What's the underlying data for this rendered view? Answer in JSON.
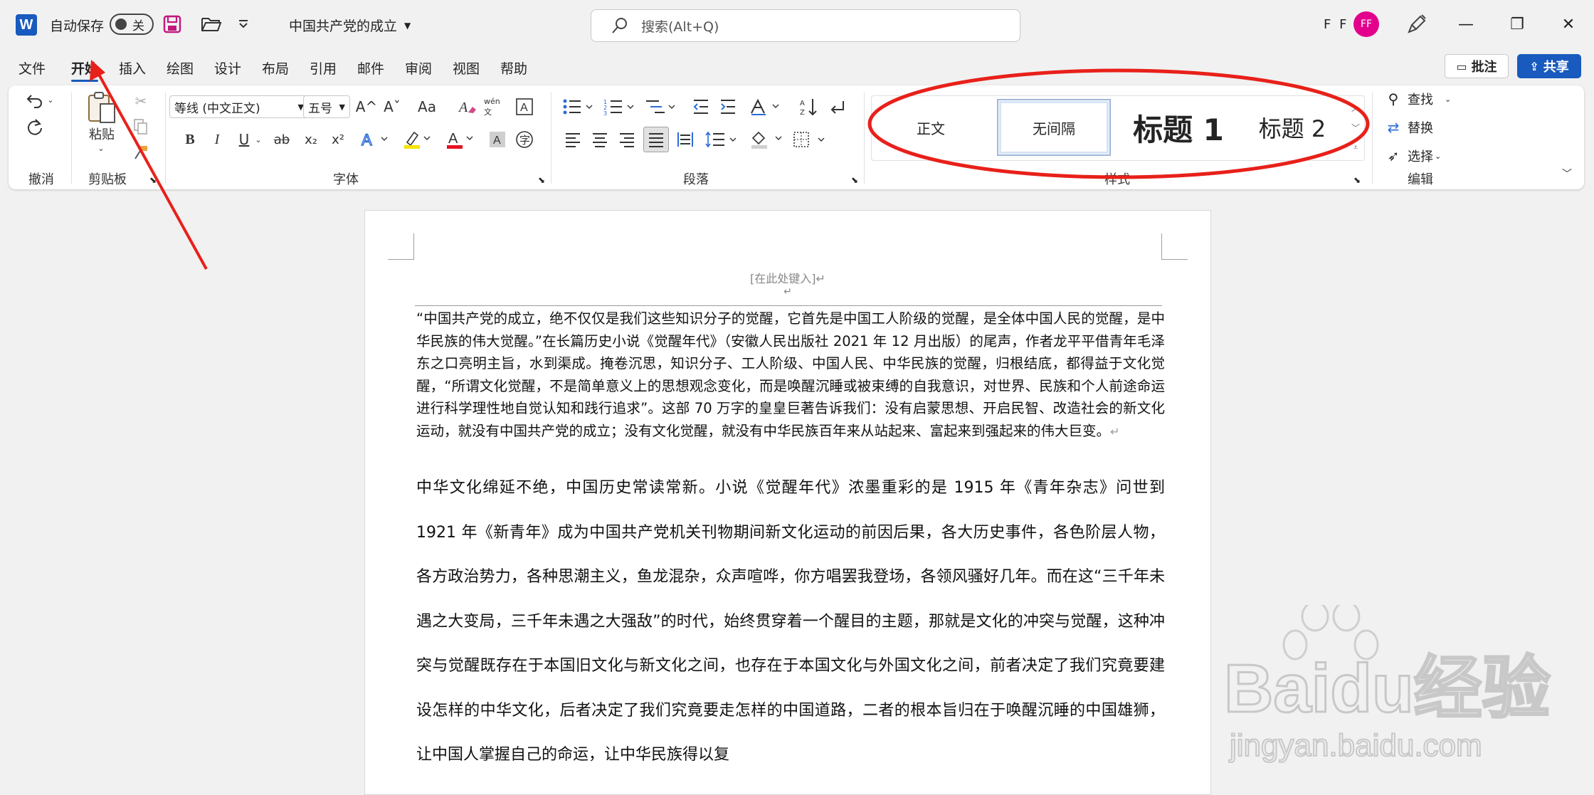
{
  "titlebar": {
    "app_logo": "W",
    "autosave_label": "自动保存",
    "autosave_state": "关",
    "doc_title": "中国共产党的成立",
    "search_placeholder": "搜索(Alt+Q)",
    "user_initials": "F F",
    "avatar_text": "FF",
    "minimize_glyph": "—",
    "restore_glyph": "❐",
    "close_glyph": "✕"
  },
  "tabs": [
    {
      "label": "文件"
    },
    {
      "label": "开始",
      "active": true
    },
    {
      "label": "插入"
    },
    {
      "label": "绘图"
    },
    {
      "label": "设计"
    },
    {
      "label": "布局"
    },
    {
      "label": "引用"
    },
    {
      "label": "邮件"
    },
    {
      "label": "审阅"
    },
    {
      "label": "视图"
    },
    {
      "label": "帮助"
    }
  ],
  "actions": {
    "comment": "批注",
    "share": "共享"
  },
  "ribbon": {
    "groups": {
      "undo": "撤消",
      "clipboard": "剪贴板",
      "font": "字体",
      "paragraph": "段落",
      "styles": "样式",
      "editing": "编辑"
    },
    "paste_label": "粘贴",
    "font_name": "等线 (中文正文)",
    "font_size": "五号",
    "font_grow": "A^",
    "font_shrink": "Aˇ",
    "change_case": "Aa",
    "phonetic": "wén文",
    "bold": "B",
    "italic": "I",
    "underline": "U",
    "strike": "ab",
    "subscript": "x₂",
    "superscript": "x²",
    "styles": [
      {
        "label": "正文"
      },
      {
        "label": "无间隔",
        "selected": true
      },
      {
        "label": "标题 1"
      },
      {
        "label": "标题 2"
      }
    ],
    "editing": {
      "find": "查找",
      "replace": "替换",
      "select": "选择"
    }
  },
  "document": {
    "header_placeholder": "[在此处键入]↵",
    "header_mark": "↵",
    "para1": "“中国共产党的成立，绝不仅仅是我们这些知识分子的觉醒，它首先是中国工人阶级的觉醒，是全体中国人民的觉醒，是中华民族的伟大觉醒。”在长篇历史小说《觉醒年代》（安徽人民出版社 2021 年 12 月出版）的尾声，作者龙平平借青年毛泽东之口亮明主旨，水到渠成。掩卷沉思，知识分子、工人阶级、中国人民、中华民族的觉醒，归根结底，都得益于文化觉醒，“所谓文化觉醒，不是简单意义上的思想观念变化，而是唤醒沉睡或被束缚的自我意识，对世界、民族和个人前途命运进行科学理性地自觉认知和践行追求”。这部 70 万字的皇皇巨著告诉我们：没有启蒙思想、开启民智、改造社会的新文化运动，就没有中国共产党的成立；没有文化觉醒，就没有中华民族百年来从站起来、富起来到强起来的伟大巨变。",
    "para1_mark": "↵",
    "para2": "中华文化绵延不绝，中国历史常读常新。小说《觉醒年代》浓墨重彩的是 1915 年《青年杂志》问世到 1921 年《新青年》成为中国共产党机关刊物期间新文化运动的前因后果，各大历史事件，各色阶层人物，各方政治势力，各种思潮主义，鱼龙混杂，众声喧哗，你方唱罢我登场，各领风骚好几年。而在这“三千年未遇之大变局，三千年未遇之大强敌”的时代，始终贯穿着一个醒目的主题，那就是文化的冲突与觉醒，这种冲突与觉醒既存在于本国旧文化与新文化之间，也存在于本国文化与外国文化之间，前者决定了我们究竟要建设怎样的中华文化，后者决定了我们究竟要走怎样的中国道路，二者的根本旨归在于唤醒沉睡的中国雄狮，让中国人掌握自己的命运，让中华民族得以复"
  },
  "watermark": {
    "brand": "Baidu经验",
    "url": "jingyan.baidu.com"
  },
  "colors": {
    "accent": "#185abd",
    "avatar": "#e3008c",
    "annotation": "#e8201a"
  }
}
